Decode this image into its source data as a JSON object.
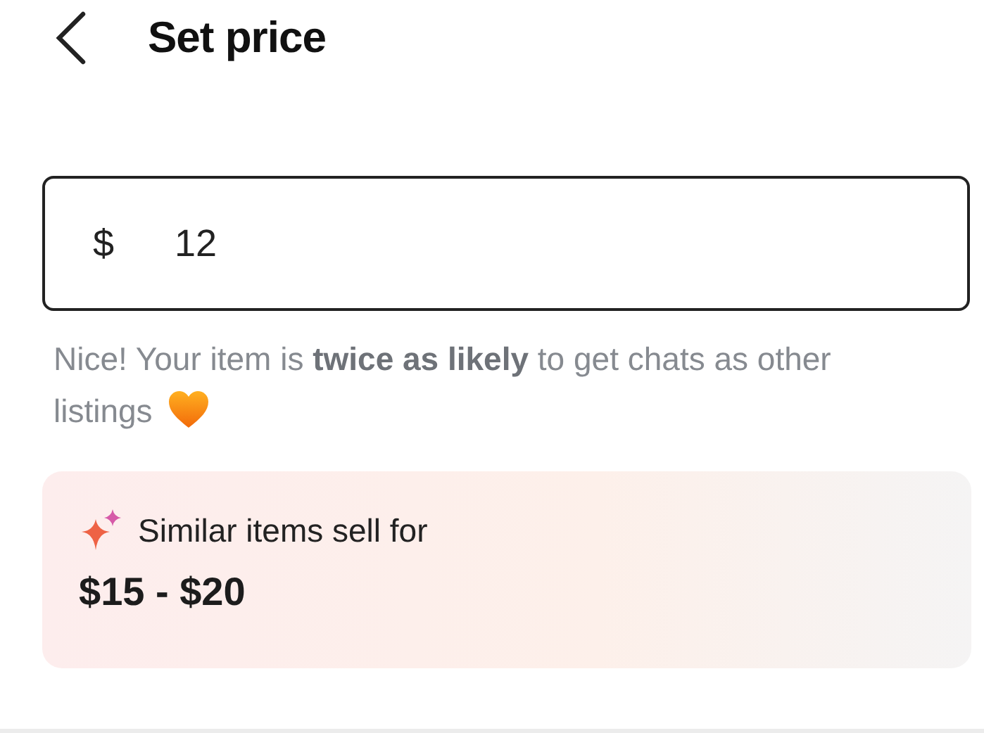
{
  "header": {
    "title": "Set price"
  },
  "price_field": {
    "currency": "$",
    "value": "12"
  },
  "hint_lines": [
    "Nice! Your item is **twice as likely** to get chats as other",
    "listings"
  ],
  "suggestion": {
    "label": "Similar items sell for",
    "range": "$15 - $20"
  }
}
